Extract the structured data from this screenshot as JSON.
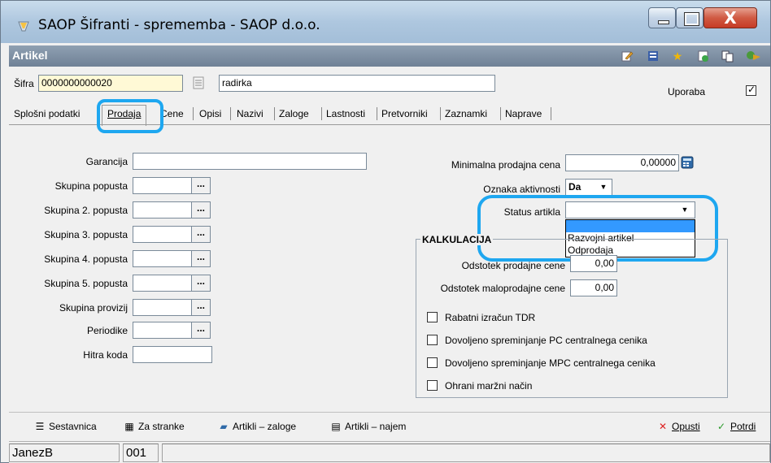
{
  "window": {
    "title": "SAOP Šifranti - sprememba - SAOP d.o.o.",
    "close_glyph": "X"
  },
  "header": {
    "title": "Artikel",
    "toolbar_icons": [
      "edit-icon",
      "list-icon",
      "star-icon",
      "refresh-icon",
      "copy-icon",
      "run-icon"
    ]
  },
  "form": {
    "sifra_label": "Šifra",
    "sifra_value": "0000000000020",
    "name_value": "radirka",
    "uporaba_label": "Uporaba",
    "uporaba_checked": true
  },
  "tabs": [
    {
      "label": "Splošni podatki"
    },
    {
      "label": "Prodaja"
    },
    {
      "label": "Cene"
    },
    {
      "label": "Opisi"
    },
    {
      "label": "Nazivi"
    },
    {
      "label": "Zaloge"
    },
    {
      "label": "Lastnosti"
    },
    {
      "label": "Pretvorniki"
    },
    {
      "label": "Zaznamki"
    },
    {
      "label": "Naprave"
    }
  ],
  "left_fields": {
    "garancija": "Garancija",
    "skupina_popusta": "Skupina popusta",
    "skupina_2": "Skupina 2. popusta",
    "skupina_3": "Skupina 3. popusta",
    "skupina_4": "Skupina 4. popusta",
    "skupina_5": "Skupina 5. popusta",
    "skupina_provizij": "Skupina provizij",
    "periodike": "Periodike",
    "hitra_koda": "Hitra koda",
    "dots": "..."
  },
  "right_fields": {
    "min_cena_label": "Minimalna prodajna cena",
    "min_cena_value": "0,00000",
    "oznaka_label": "Oznaka aktivnosti",
    "oznaka_value": "Da",
    "status_label": "Status artikla",
    "status_value": "",
    "status_options": [
      "",
      "Razvojni artikel",
      "Odprodaja"
    ]
  },
  "kalkulacija": {
    "title": "KALKULACIJA",
    "odstotek_prodajne_label": "Odstotek prodajne cene",
    "odstotek_prodajne_value": "0,00",
    "odstotek_malo_label": "Odstotek maloprodajne cene",
    "odstotek_malo_value": "0,00",
    "checkboxes": [
      {
        "label": "Rabatni izračun TDR",
        "checked": false
      },
      {
        "label": "Dovoljeno spreminjanje PC centralnega cenika",
        "checked": false
      },
      {
        "label": "Dovoljeno spreminjanje MPC centralnega cenika",
        "checked": false
      },
      {
        "label": "Ohrani maržni način",
        "checked": false
      }
    ]
  },
  "bottom": {
    "sestavnica": "Sestavnica",
    "za_stranke": "Za stranke",
    "artikli_zaloge": "Artikli – zaloge",
    "artikli_najem": "Artikli – najem",
    "opusti": "Opusti",
    "potrdi": "Potrdi"
  },
  "status": {
    "user": "JanezB",
    "code": "001"
  }
}
